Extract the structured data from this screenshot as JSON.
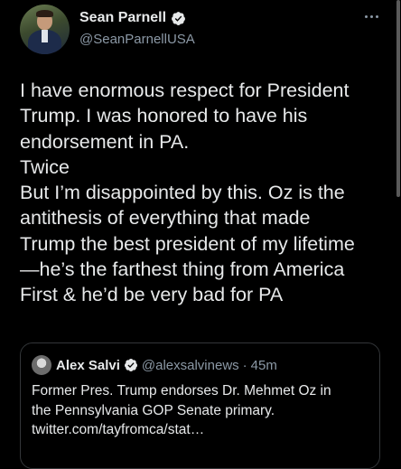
{
  "tweet": {
    "author": {
      "name": "Sean Parnell",
      "handle": "@SeanParnellUSA",
      "verified": true
    },
    "more_icon": "more-horizontal-icon",
    "text_lines": [
      "I have enormous respect for President",
      "Trump. I was honored to have his",
      "endorsement in PA.",
      "Twice",
      "But I’m disappointed by this. Oz is the",
      "antithesis of everything that made",
      "Trump the best president of my lifetime",
      "—he’s the farthest thing from America",
      "First & he’d be very bad for PA"
    ]
  },
  "quoted_tweet": {
    "author": {
      "name": "Alex Salvi",
      "handle": "@alexsalvinews",
      "separator": "·",
      "time": "45m",
      "verified": true
    },
    "text_lines": [
      "Former Pres. Trump endorses Dr. Mehmet Oz in",
      "the Pennsylvania GOP Senate primary.",
      "twitter.com/tayfromca/stat…"
    ]
  },
  "colors": {
    "background": "#000000",
    "text": "#e7e9ea",
    "secondary_text": "#8b98a5",
    "verified_blue": "#1d9bf0",
    "quote_border": "#333639"
  }
}
